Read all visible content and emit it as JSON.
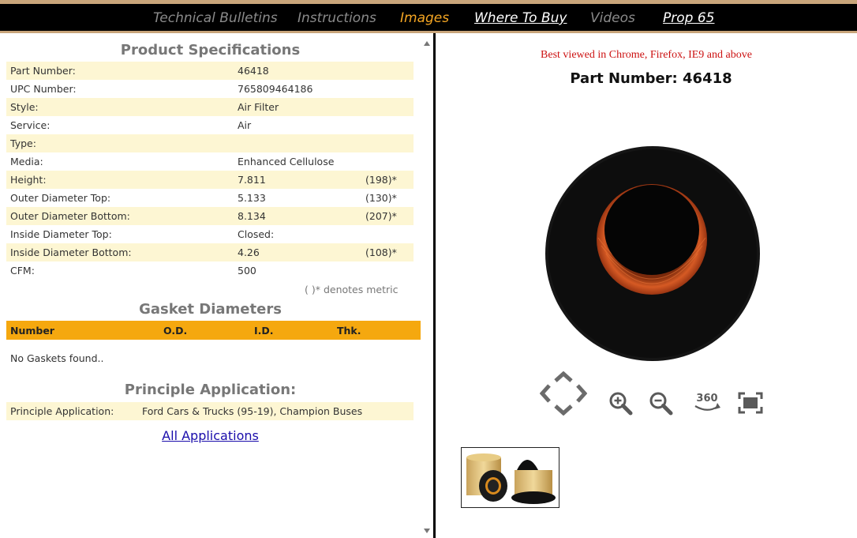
{
  "nav": {
    "items": [
      {
        "label": "Technical Bulletins",
        "style": "muted"
      },
      {
        "label": "Instructions",
        "style": "muted"
      },
      {
        "label": "Images",
        "style": "active"
      },
      {
        "label": "Where To Buy",
        "style": "link"
      },
      {
        "label": "Videos",
        "style": "muted"
      },
      {
        "label": "Prop 65",
        "style": "link"
      }
    ]
  },
  "specs": {
    "title": "Product Specifications",
    "rows": [
      {
        "label": "Part Number:",
        "value": "46418",
        "metric": ""
      },
      {
        "label": "UPC Number:",
        "value": "765809464186",
        "metric": ""
      },
      {
        "label": "Style:",
        "value": "Air Filter",
        "metric": ""
      },
      {
        "label": "Service:",
        "value": "Air",
        "metric": ""
      },
      {
        "label": "Type:",
        "value": "",
        "metric": ""
      },
      {
        "label": "Media:",
        "value": "Enhanced Cellulose",
        "metric": ""
      },
      {
        "label": "Height:",
        "value": "7.811",
        "metric": "(198)*"
      },
      {
        "label": "Outer Diameter Top:",
        "value": "5.133",
        "metric": "(130)*"
      },
      {
        "label": "Outer Diameter Bottom:",
        "value": "8.134",
        "metric": "(207)*"
      },
      {
        "label": "Inside Diameter Top:",
        "value": "Closed:",
        "metric": ""
      },
      {
        "label": "Inside Diameter Bottom:",
        "value": "4.26",
        "metric": "(108)*"
      },
      {
        "label": "CFM:",
        "value": "500",
        "metric": ""
      }
    ],
    "metric_note": "(  )* denotes metric"
  },
  "gaskets": {
    "title": "Gasket Diameters",
    "columns": [
      "Number",
      "O.D.",
      "I.D.",
      "Thk."
    ],
    "empty_text": "No Gaskets found.."
  },
  "application": {
    "title": "Principle Application:",
    "label": "Principle Application:",
    "value": "Ford Cars & Trucks (95-19), Champion Buses",
    "all_link": "All Applications"
  },
  "viewer": {
    "browser_note": "Best viewed in Chrome, Firefox, IE9 and above",
    "heading": "Part Number: 46418",
    "rotate_label": "360",
    "icons": [
      "pan-arrows-icon",
      "zoom-in-icon",
      "zoom-out-icon",
      "rotate-360-icon",
      "fullscreen-icon"
    ]
  },
  "colors": {
    "nav_bg": "#000000",
    "nav_border": "#c8a57a",
    "active_nav": "#f5a623",
    "row_shade": "#fdf6d3",
    "gasket_header": "#f5a80f",
    "warning_text": "#cc1111",
    "link": "#1a0dab"
  }
}
